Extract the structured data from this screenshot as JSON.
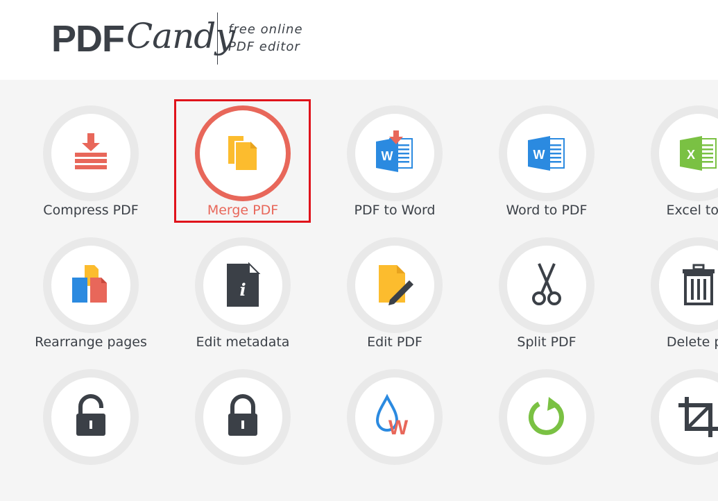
{
  "header": {
    "logo_pdf": "PDF",
    "logo_candy": "Candy",
    "tagline_line1": "free online",
    "tagline_line2": "PDF editor"
  },
  "colors": {
    "accent": "#e8675a",
    "highlight": "#e0131b",
    "text": "#3b4047",
    "word_blue": "#2b8ae0",
    "excel_green": "#7ac143",
    "merge_yellow": "#fcbc2e"
  },
  "tools": [
    {
      "label": "Compress PDF",
      "icon": "compress-icon"
    },
    {
      "label": "Merge PDF",
      "icon": "merge-icon",
      "active": true
    },
    {
      "label": "PDF to Word",
      "icon": "pdf-to-word-icon"
    },
    {
      "label": "Word to PDF",
      "icon": "word-icon"
    },
    {
      "label": "Excel to P",
      "icon": "excel-icon"
    },
    {
      "label": "Rearrange pages",
      "icon": "rearrange-icon"
    },
    {
      "label": "Edit metadata",
      "icon": "metadata-icon"
    },
    {
      "label": "Edit PDF",
      "icon": "edit-pdf-icon"
    },
    {
      "label": "Split PDF",
      "icon": "scissors-icon"
    },
    {
      "label": "Delete pa",
      "icon": "trash-icon"
    },
    {
      "label": "",
      "icon": "unlock-icon"
    },
    {
      "label": "",
      "icon": "lock-icon"
    },
    {
      "label": "",
      "icon": "watermark-icon"
    },
    {
      "label": "",
      "icon": "rotate-icon"
    },
    {
      "label": "",
      "icon": "crop-icon"
    }
  ]
}
